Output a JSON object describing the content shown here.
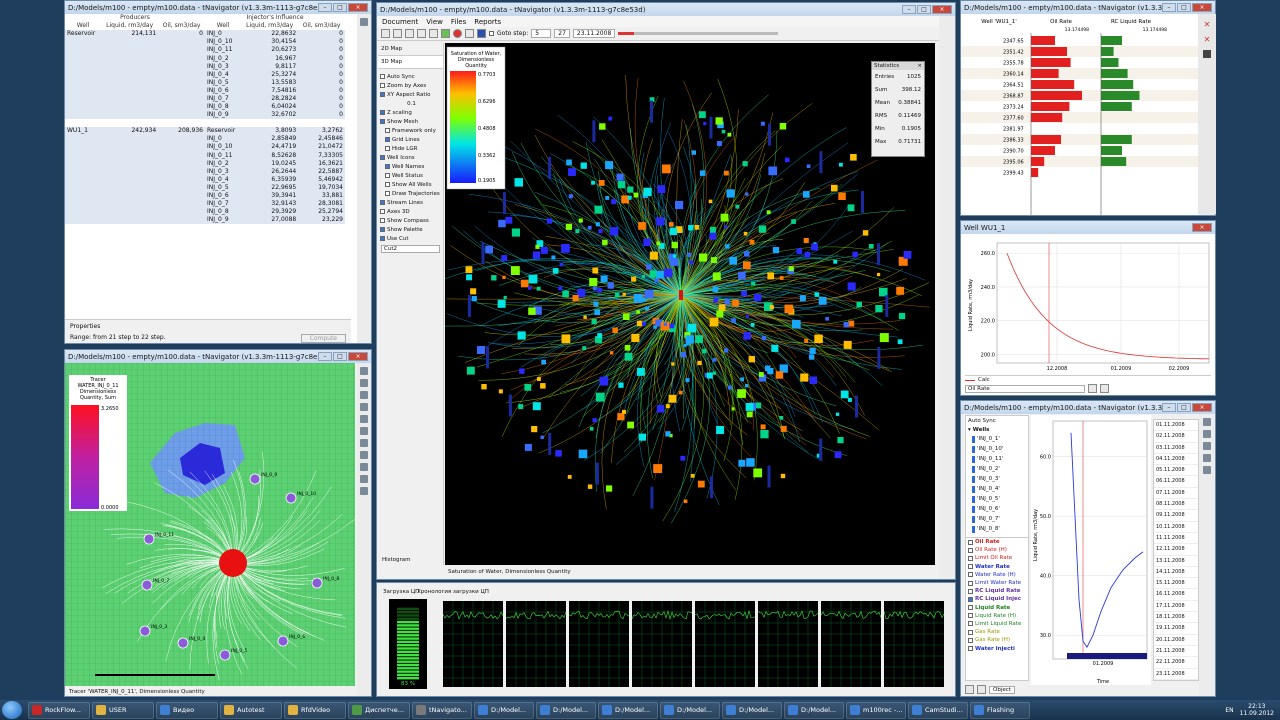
{
  "colors": {
    "desktop": "#1f3d5c",
    "accent": "#2a6ad8",
    "oil": "#e32020",
    "water": "#2a8a2a"
  },
  "influence": {
    "title": "D:/Models/m100 - empty/m100.data - tNavigator (v1.3.3m-1113-g7c8e53d)",
    "header_groups": [
      "Producers",
      "Injector's Influence"
    ],
    "columns": [
      "Well",
      "Liquid, rm3/day",
      "Oil, sm3/day",
      "Well",
      "Liquid, rm3/day",
      "Oil, sm3/day"
    ],
    "block1": {
      "producer": "Reservoir",
      "liquid": "214,131",
      "oil": "0",
      "rows": [
        [
          "INJ_0",
          "22,8632",
          "0"
        ],
        [
          "INJ_0_10",
          "30,4154",
          "0"
        ],
        [
          "INJ_0_11",
          "20,6273",
          "0"
        ],
        [
          "INJ_0_2",
          "16,967",
          "0"
        ],
        [
          "INJ_0_3",
          "9,8117",
          "0"
        ],
        [
          "INJ_0_4",
          "25,3274",
          "0"
        ],
        [
          "INJ_0_5",
          "13,5583",
          "0"
        ],
        [
          "INJ_0_6",
          "7,54816",
          "0"
        ],
        [
          "INJ_0_7",
          "28,2824",
          "0"
        ],
        [
          "INJ_0_8",
          "6,04024",
          "0"
        ],
        [
          "INJ_0_9",
          "32,6702",
          "0"
        ]
      ]
    },
    "block2": {
      "producer": "WU1_1",
      "liquid": "242,934",
      "oil": "208,936",
      "rows": [
        [
          "Reservoir",
          "3,8093",
          "3,2762"
        ],
        [
          "INJ_0",
          "2,85849",
          "2,45846"
        ],
        [
          "INJ_0_10",
          "24,4719",
          "21,0472"
        ],
        [
          "INJ_0_11",
          "8,52628",
          "7,33305"
        ],
        [
          "INJ_0_2",
          "19,0245",
          "16,3621"
        ],
        [
          "INJ_0_3",
          "26,2644",
          "22,5887"
        ],
        [
          "INJ_0_4",
          "6,35939",
          "5,46942"
        ],
        [
          "INJ_0_5",
          "22,9695",
          "19,7034"
        ],
        [
          "INJ_0_6",
          "39,3941",
          "33,881"
        ],
        [
          "INJ_0_7",
          "32,9143",
          "28,3081"
        ],
        [
          "INJ_0_8",
          "29,3929",
          "25,2794"
        ],
        [
          "INJ_0_9",
          "27,0088",
          "23,229"
        ]
      ]
    },
    "properties_label": "Properties",
    "range_text": "Range: from 21 step to 22 step.",
    "compute_label": "Compute"
  },
  "tracer": {
    "title": "D:/Models/m100 - empty/m100.data - tNavigator (v1.3.3m-1113-g7c8e53d)",
    "legend_title": [
      "Tracer",
      "WATER_INJ_0_11",
      "Dimensionless",
      "Quantity, Sum"
    ],
    "legend_max": "3.2650",
    "legend_min": "0.0000",
    "well_labels": [
      "INJ_0_9",
      "INJ_0_10",
      "INJ_0_11",
      "INJ_0_8",
      "INJ_0_7",
      "INJ_0_6",
      "INJ_0_5",
      "INJ_0_4",
      "INJ_0_3"
    ],
    "footer": "Tracer 'WATER_INJ_0_11', Dimensionless Quantity"
  },
  "main": {
    "title": "D:/Models/m100 - empty/m100.data - tNavigator (v1.3.3m-1113-g7c8e53d)",
    "menu": [
      "Document",
      "View",
      "Files",
      "Reports"
    ],
    "goto_label": "Goto step:",
    "goto_value": "5",
    "step_value": "27",
    "date_value": "23.11.2008",
    "tabs": [
      "2D Map",
      "3D Map"
    ],
    "options": [
      {
        "label": "Auto Sync",
        "on": false
      },
      {
        "label": "Zoom by Axes",
        "on": false
      },
      {
        "label": "XY Aspect Ratio",
        "on": true
      },
      {
        "label": "Z scaling",
        "on": true
      },
      {
        "label": "Show Mesh",
        "on": true
      },
      {
        "label": "Framework only",
        "on": false
      },
      {
        "label": "Grid Lines",
        "on": true
      },
      {
        "label": "Hide LGR",
        "on": false
      },
      {
        "label": "Well Icons",
        "on": true
      },
      {
        "label": "Well Names",
        "on": true
      },
      {
        "label": "Well Status",
        "on": false
      },
      {
        "label": "Show All Wells",
        "on": false
      },
      {
        "label": "Draw Trajectories",
        "on": false
      },
      {
        "label": "Stream Lines",
        "on": true
      },
      {
        "label": "Axes 3D",
        "on": false
      },
      {
        "label": "Show Compass",
        "on": false
      },
      {
        "label": "Show Palette",
        "on": true
      },
      {
        "label": "Use Cut",
        "on": true
      }
    ],
    "z_scale_value": "0.1",
    "cut_value": "Cut2",
    "histogram_label": "Histogram",
    "status_text": "Saturation of Water, Dimensionless Quantity",
    "palette_title": [
      "Saturation of Water,",
      "Dimensionless",
      "Quantity"
    ],
    "palette_ticks": [
      "0.7703",
      "0.6296",
      "0.4808",
      "0.3362",
      "0.1905"
    ],
    "stats_title": "Statistics",
    "stats": [
      [
        "Entries",
        "1025"
      ],
      [
        "Sum",
        "398.12"
      ],
      [
        "Mean",
        "0.38841"
      ],
      [
        "RMS",
        "0.11469"
      ],
      [
        "Min",
        "0.1905"
      ],
      [
        "Max",
        "0.71731"
      ]
    ]
  },
  "monitor": {
    "cpu_label": "Загрузка ЦП",
    "history_label": "Хронология загрузки ЦП",
    "cpu_percent_text": "83 %",
    "cpu_level": 0.83
  },
  "welllog": {
    "title": "D:/Models/m100 - empty/m100.data - tNavigator (v1.3.3m-1113-g7c8e53d)",
    "col_well": "Well 'WU1_1'",
    "col_oil": "Oil Rate",
    "col_liquid": "RC Liquid Rate",
    "oil_scale": "13.174498",
    "liquid_scale": "13.174498",
    "depths": [
      "2347.65",
      "2351.42",
      "2355.78",
      "2360.14",
      "2364.51",
      "2368.87",
      "2373.24",
      "2377.60",
      "2381.97",
      "2386.33",
      "2390.70",
      "2395.06",
      "2399.43"
    ]
  },
  "wellchart": {
    "title": "Well WU1_1",
    "yticks": [
      "260.0",
      "240.0",
      "220.0",
      "200.0"
    ],
    "xticks": [
      "12.2008",
      "01.2009",
      "02.2009"
    ],
    "ylabel": "Liquid Rate, rm3/day",
    "legend": "Calc",
    "select_value": "Oil Rate"
  },
  "wellpanel": {
    "title": "D:/Models/m100 - empty/m100.data - tNavigator (v1.3.3m-1113-g7c8e53d)",
    "auto_sync": "Auto Sync",
    "wells_label": "Wells",
    "wells": [
      "'INJ_0_1'",
      "'INJ_0_10'",
      "'INJ_0_11'",
      "'INJ_0_2'",
      "'INJ_0_3'",
      "'INJ_0_4'",
      "'INJ_0_5'",
      "'INJ_0_6'",
      "'INJ_0_7'",
      "'INJ_0_8'"
    ],
    "params": [
      {
        "label": "Oil Rate",
        "color": "#d02020",
        "bold": true
      },
      {
        "label": "Oil Rate (H)",
        "color": "#d02020",
        "bold": false
      },
      {
        "label": "Limit Oil Rate",
        "color": "#d02020",
        "bold": false
      },
      {
        "label": "Water Rate",
        "color": "#2030c0",
        "bold": true
      },
      {
        "label": "Water Rate (H)",
        "color": "#2030c0",
        "bold": false
      },
      {
        "label": "Limit Water Rate",
        "color": "#2030c0",
        "bold": false
      },
      {
        "label": "RC Liquid Rate",
        "color": "#6030a0",
        "bold": true
      },
      {
        "label": "RC Liquid Injec",
        "color": "#6030a0",
        "bold": true
      },
      {
        "label": "Liquid Rate",
        "color": "#208020",
        "bold": true
      },
      {
        "label": "Liquid Rate (H)",
        "color": "#208020",
        "bold": false
      },
      {
        "label": "Limit Liquid Rate",
        "color": "#208020",
        "bold": false
      },
      {
        "label": "Gas Rate",
        "color": "#999900",
        "bold": false
      },
      {
        "label": "Gas Rate (H)",
        "color": "#999900",
        "bold": false
      },
      {
        "label": "Water Injecti",
        "color": "#2030c0",
        "bold": true
      }
    ],
    "yticks": [
      "60.0",
      "50.0",
      "40.0",
      "30.0"
    ],
    "ylabel": "Liquid Rate, rm3/day",
    "xtick": "01.2009",
    "xlabel": "Time",
    "dates": [
      "01.11.2008",
      "02.11.2008",
      "03.11.2008",
      "04.11.2008",
      "05.11.2008",
      "06.11.2008",
      "07.11.2008",
      "08.11.2008",
      "09.11.2008",
      "10.11.2008",
      "11.11.2008",
      "12.11.2008",
      "13.11.2008",
      "14.11.2008",
      "15.11.2008",
      "16.11.2008",
      "17.11.2008",
      "18.11.2008",
      "19.11.2008",
      "20.11.2008",
      "21.11.2008",
      "22.11.2008",
      "23.11.2008"
    ],
    "object_label": "Object"
  },
  "taskbar": {
    "items": [
      {
        "label": "RockFlow...",
        "color": "#c62828"
      },
      {
        "label": "USER",
        "color": "#e3b341"
      },
      {
        "label": "Видео",
        "color": "#3f7fd3"
      },
      {
        "label": "Autotest",
        "color": "#e3b341"
      },
      {
        "label": "RfdVideo",
        "color": "#e3b341"
      },
      {
        "label": "Диспетче...",
        "color": "#4f9a46"
      },
      {
        "label": "tNavigato...",
        "color": "#7a7a7a"
      },
      {
        "label": "D:/Model...",
        "color": "#3f7fd3"
      },
      {
        "label": "D:/Model...",
        "color": "#3f7fd3"
      },
      {
        "label": "D:/Model...",
        "color": "#3f7fd3"
      },
      {
        "label": "D:/Model...",
        "color": "#3f7fd3"
      },
      {
        "label": "D:/Model...",
        "color": "#3f7fd3"
      },
      {
        "label": "D:/Model...",
        "color": "#3f7fd3"
      },
      {
        "label": "m100rec -...",
        "color": "#3f7fd3"
      },
      {
        "label": "CamStudi...",
        "color": "#3f7fd3"
      },
      {
        "label": "Flashing",
        "color": "#3f7fd3"
      }
    ],
    "lang": "EN",
    "time": "22:13",
    "date": "11.09.2012"
  }
}
